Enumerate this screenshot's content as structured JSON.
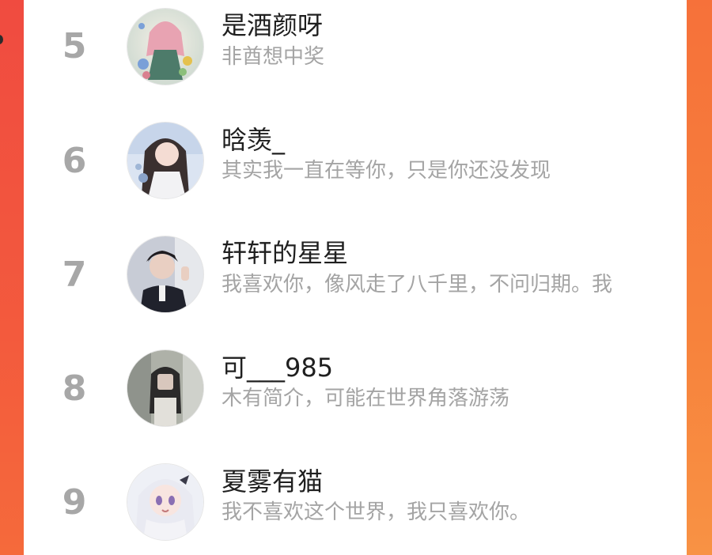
{
  "leaderboard": {
    "rows": [
      {
        "rank": "5",
        "name": "是酒颜呀",
        "bio": "非酋想中奖",
        "avatar_icon": "avatar-anime-girl-flowers-icon"
      },
      {
        "rank": "6",
        "name": "晗羡_",
        "bio": "其实我一直在等你，只是你还没发现",
        "avatar_icon": "avatar-anime-girl-dark-hair-icon"
      },
      {
        "rank": "7",
        "name": "轩轩的星星",
        "bio": "我喜欢你，像风走了八千里，不问归期。我",
        "avatar_icon": "avatar-boy-photo-icon"
      },
      {
        "rank": "8",
        "name": "可___985",
        "bio": "木有简介，可能在世界角落游荡",
        "avatar_icon": "avatar-girl-photo-icon"
      },
      {
        "rank": "9",
        "name": "夏雾有猫",
        "bio": "我不喜欢这个世界，我只喜欢你。",
        "avatar_icon": "avatar-anime-girl-white-hair-icon"
      }
    ]
  },
  "colors": {
    "frame": "#f34a3e",
    "rank": "#a7a7a7",
    "name": "#1f1f1f",
    "bio": "#a4a4a4",
    "panel": "#ffffff"
  }
}
